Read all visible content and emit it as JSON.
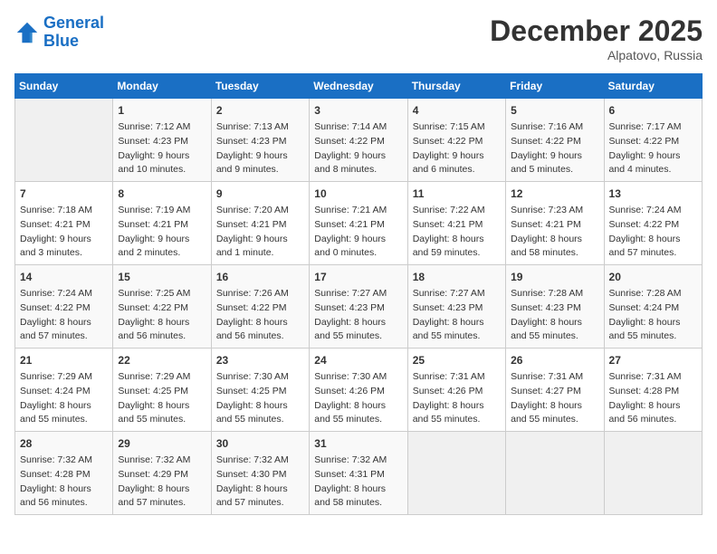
{
  "header": {
    "logo_line1": "General",
    "logo_line2": "Blue",
    "month": "December 2025",
    "location": "Alpatovo, Russia"
  },
  "weekdays": [
    "Sunday",
    "Monday",
    "Tuesday",
    "Wednesday",
    "Thursday",
    "Friday",
    "Saturday"
  ],
  "weeks": [
    [
      {
        "day": "",
        "info": ""
      },
      {
        "day": "1",
        "info": "Sunrise: 7:12 AM\nSunset: 4:23 PM\nDaylight: 9 hours\nand 10 minutes."
      },
      {
        "day": "2",
        "info": "Sunrise: 7:13 AM\nSunset: 4:23 PM\nDaylight: 9 hours\nand 9 minutes."
      },
      {
        "day": "3",
        "info": "Sunrise: 7:14 AM\nSunset: 4:22 PM\nDaylight: 9 hours\nand 8 minutes."
      },
      {
        "day": "4",
        "info": "Sunrise: 7:15 AM\nSunset: 4:22 PM\nDaylight: 9 hours\nand 6 minutes."
      },
      {
        "day": "5",
        "info": "Sunrise: 7:16 AM\nSunset: 4:22 PM\nDaylight: 9 hours\nand 5 minutes."
      },
      {
        "day": "6",
        "info": "Sunrise: 7:17 AM\nSunset: 4:22 PM\nDaylight: 9 hours\nand 4 minutes."
      }
    ],
    [
      {
        "day": "7",
        "info": "Sunrise: 7:18 AM\nSunset: 4:21 PM\nDaylight: 9 hours\nand 3 minutes."
      },
      {
        "day": "8",
        "info": "Sunrise: 7:19 AM\nSunset: 4:21 PM\nDaylight: 9 hours\nand 2 minutes."
      },
      {
        "day": "9",
        "info": "Sunrise: 7:20 AM\nSunset: 4:21 PM\nDaylight: 9 hours\nand 1 minute."
      },
      {
        "day": "10",
        "info": "Sunrise: 7:21 AM\nSunset: 4:21 PM\nDaylight: 9 hours\nand 0 minutes."
      },
      {
        "day": "11",
        "info": "Sunrise: 7:22 AM\nSunset: 4:21 PM\nDaylight: 8 hours\nand 59 minutes."
      },
      {
        "day": "12",
        "info": "Sunrise: 7:23 AM\nSunset: 4:21 PM\nDaylight: 8 hours\nand 58 minutes."
      },
      {
        "day": "13",
        "info": "Sunrise: 7:24 AM\nSunset: 4:22 PM\nDaylight: 8 hours\nand 57 minutes."
      }
    ],
    [
      {
        "day": "14",
        "info": "Sunrise: 7:24 AM\nSunset: 4:22 PM\nDaylight: 8 hours\nand 57 minutes."
      },
      {
        "day": "15",
        "info": "Sunrise: 7:25 AM\nSunset: 4:22 PM\nDaylight: 8 hours\nand 56 minutes."
      },
      {
        "day": "16",
        "info": "Sunrise: 7:26 AM\nSunset: 4:22 PM\nDaylight: 8 hours\nand 56 minutes."
      },
      {
        "day": "17",
        "info": "Sunrise: 7:27 AM\nSunset: 4:23 PM\nDaylight: 8 hours\nand 55 minutes."
      },
      {
        "day": "18",
        "info": "Sunrise: 7:27 AM\nSunset: 4:23 PM\nDaylight: 8 hours\nand 55 minutes."
      },
      {
        "day": "19",
        "info": "Sunrise: 7:28 AM\nSunset: 4:23 PM\nDaylight: 8 hours\nand 55 minutes."
      },
      {
        "day": "20",
        "info": "Sunrise: 7:28 AM\nSunset: 4:24 PM\nDaylight: 8 hours\nand 55 minutes."
      }
    ],
    [
      {
        "day": "21",
        "info": "Sunrise: 7:29 AM\nSunset: 4:24 PM\nDaylight: 8 hours\nand 55 minutes."
      },
      {
        "day": "22",
        "info": "Sunrise: 7:29 AM\nSunset: 4:25 PM\nDaylight: 8 hours\nand 55 minutes."
      },
      {
        "day": "23",
        "info": "Sunrise: 7:30 AM\nSunset: 4:25 PM\nDaylight: 8 hours\nand 55 minutes."
      },
      {
        "day": "24",
        "info": "Sunrise: 7:30 AM\nSunset: 4:26 PM\nDaylight: 8 hours\nand 55 minutes."
      },
      {
        "day": "25",
        "info": "Sunrise: 7:31 AM\nSunset: 4:26 PM\nDaylight: 8 hours\nand 55 minutes."
      },
      {
        "day": "26",
        "info": "Sunrise: 7:31 AM\nSunset: 4:27 PM\nDaylight: 8 hours\nand 55 minutes."
      },
      {
        "day": "27",
        "info": "Sunrise: 7:31 AM\nSunset: 4:28 PM\nDaylight: 8 hours\nand 56 minutes."
      }
    ],
    [
      {
        "day": "28",
        "info": "Sunrise: 7:32 AM\nSunset: 4:28 PM\nDaylight: 8 hours\nand 56 minutes."
      },
      {
        "day": "29",
        "info": "Sunrise: 7:32 AM\nSunset: 4:29 PM\nDaylight: 8 hours\nand 57 minutes."
      },
      {
        "day": "30",
        "info": "Sunrise: 7:32 AM\nSunset: 4:30 PM\nDaylight: 8 hours\nand 57 minutes."
      },
      {
        "day": "31",
        "info": "Sunrise: 7:32 AM\nSunset: 4:31 PM\nDaylight: 8 hours\nand 58 minutes."
      },
      {
        "day": "",
        "info": ""
      },
      {
        "day": "",
        "info": ""
      },
      {
        "day": "",
        "info": ""
      }
    ]
  ]
}
